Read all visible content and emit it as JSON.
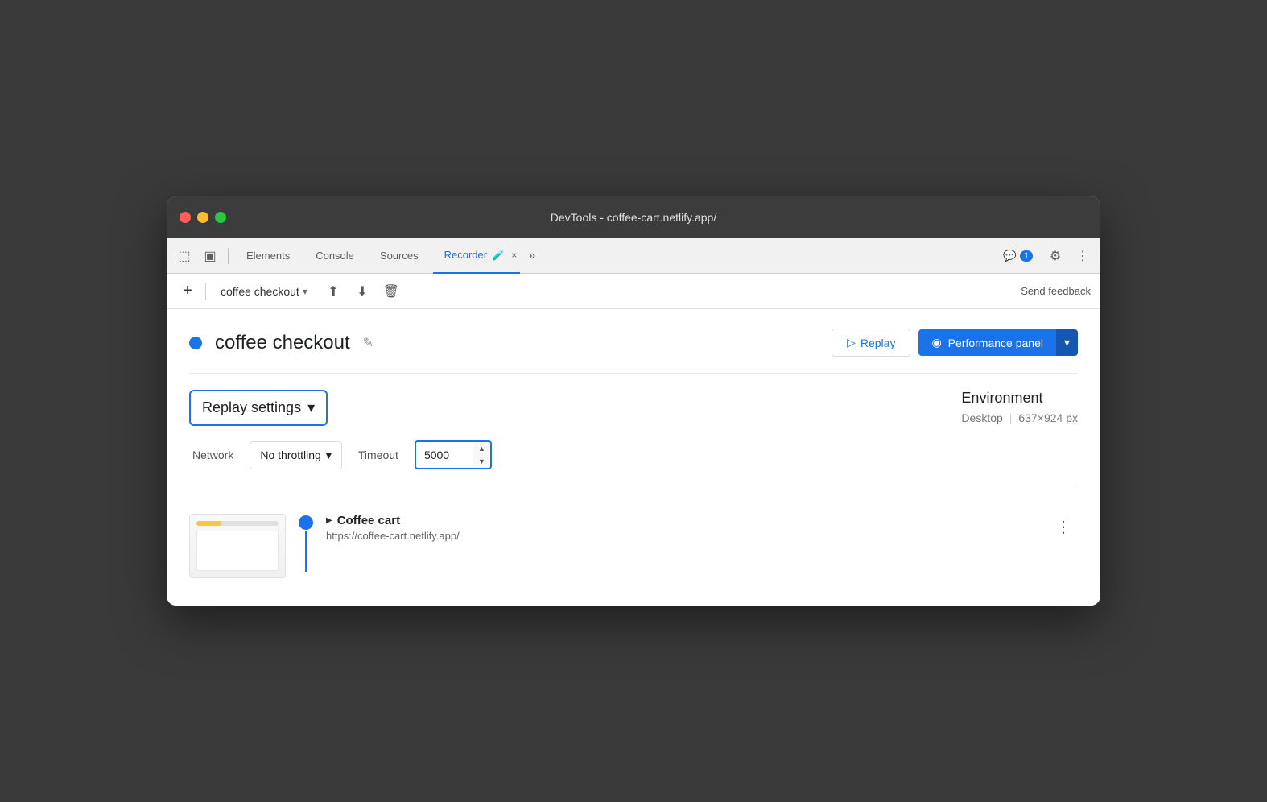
{
  "window": {
    "title": "DevTools - coffee-cart.netlify.app/"
  },
  "titlebar": {
    "traffic_lights": [
      "red",
      "yellow",
      "green"
    ]
  },
  "toolbar": {
    "tabs": [
      {
        "label": "Elements",
        "active": false
      },
      {
        "label": "Console",
        "active": false
      },
      {
        "label": "Sources",
        "active": false
      },
      {
        "label": "Recorder",
        "active": true
      }
    ],
    "recorder_close": "×",
    "more_tabs": "»",
    "badge_count": "1",
    "icons": {
      "cursor": "⬚",
      "panel": "▣"
    }
  },
  "secondary_toolbar": {
    "add_label": "+",
    "recording_name": "coffee checkout",
    "send_feedback": "Send feedback"
  },
  "recording": {
    "title": "coffee checkout",
    "dot_color": "#1a73e8",
    "replay_label": "Replay",
    "performance_panel_label": "Performance panel"
  },
  "replay_settings": {
    "label": "Replay settings",
    "network_label": "Network",
    "throttling_label": "No throttling",
    "timeout_label": "Timeout",
    "timeout_value": "5000",
    "environment_title": "Environment",
    "environment_device": "Desktop",
    "environment_size": "637×924 px"
  },
  "steps": [
    {
      "title": "Coffee cart",
      "url": "https://coffee-cart.netlify.app/"
    }
  ],
  "icons": {
    "play": "▷",
    "chevron_down": "▾",
    "chevron_right": "▶",
    "edit": "✎",
    "upload": "⬆",
    "download": "⬇",
    "trash": "🗑",
    "settings": "⚙",
    "more_vert": "⋮",
    "timer": "⏱",
    "perf": "◉",
    "message": "💬"
  }
}
